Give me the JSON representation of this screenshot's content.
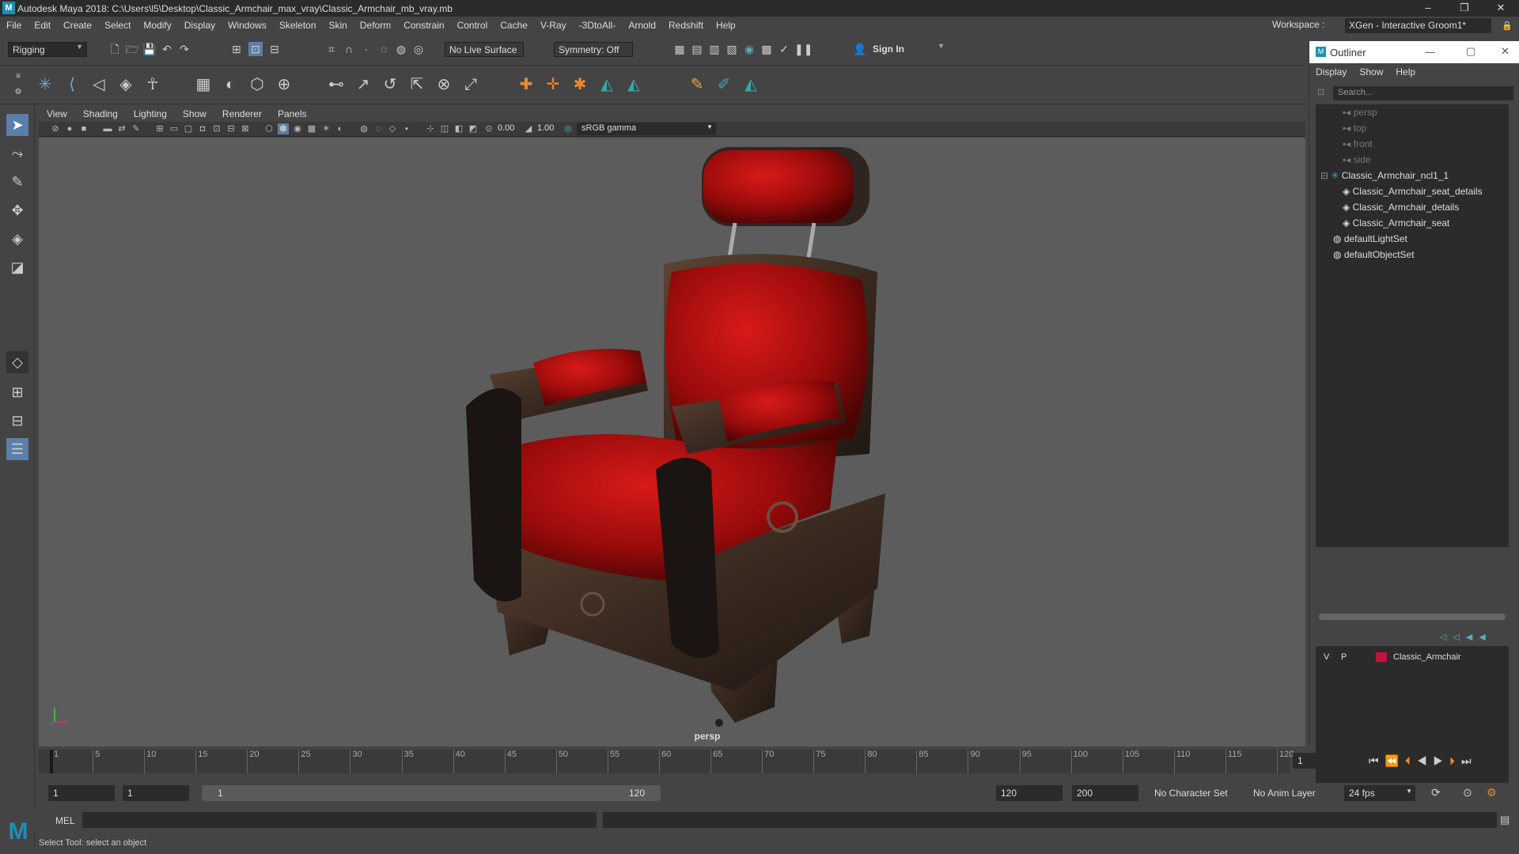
{
  "window": {
    "title": "Autodesk Maya 2018: C:\\Users\\l5\\Desktop\\Classic_Armchair_max_vray\\Classic_Armchair_mb_vray.mb",
    "minimize": "–",
    "maximize": "❐",
    "close": "✕"
  },
  "menus": [
    "File",
    "Edit",
    "Create",
    "Select",
    "Modify",
    "Display",
    "Windows",
    "Skeleton",
    "Skin",
    "Deform",
    "Constrain",
    "Control",
    "Cache",
    "V-Ray",
    "-3DtoAll-",
    "Arnold",
    "Redshift",
    "Help"
  ],
  "workspace": {
    "label": "Workspace :",
    "value": "XGen - Interactive Groom1*"
  },
  "statusline": {
    "mode": "Rigging",
    "live_surface": "No Live Surface",
    "symmetry": "Symmetry: Off",
    "sign_in": "Sign In"
  },
  "viewport": {
    "menus": [
      "View",
      "Shading",
      "Lighting",
      "Show",
      "Renderer",
      "Panels"
    ],
    "exposure": "0.00",
    "gamma": "1.00",
    "color_space": "sRGB gamma",
    "camera": "persp"
  },
  "outliner": {
    "title": "Outliner",
    "menus": [
      "Display",
      "Show",
      "Help"
    ],
    "search_placeholder": "Search...",
    "items": [
      {
        "label": "persp",
        "dim": true
      },
      {
        "label": "top",
        "dim": true
      },
      {
        "label": "front",
        "dim": true
      },
      {
        "label": "side",
        "dim": true
      },
      {
        "label": "Classic_Armchair_ncl1_1",
        "dim": false
      },
      {
        "label": "Classic_Armchair_seat_details",
        "dim": false
      },
      {
        "label": "Classic_Armchair_details",
        "dim": false
      },
      {
        "label": "Classic_Armchair_seat",
        "dim": false
      },
      {
        "label": "defaultLightSet",
        "dim": false
      },
      {
        "label": "defaultObjectSet",
        "dim": false
      }
    ]
  },
  "layers": {
    "v": "V",
    "p": "P",
    "name": "Classic_Armchair",
    "color": "#c0143c"
  },
  "timeline": {
    "ticks": [
      "1",
      "5",
      "10",
      "15",
      "20",
      "25",
      "30",
      "35",
      "40",
      "45",
      "50",
      "55",
      "60",
      "65",
      "70",
      "75",
      "80",
      "85",
      "90",
      "95",
      "100",
      "105",
      "110",
      "115",
      "120"
    ],
    "current_frame": "1"
  },
  "range": {
    "start": "1",
    "playback_start": "1",
    "slider_start": "1",
    "slider_end": "120",
    "playback_end": "120",
    "end": "200",
    "character_set": "No Character Set",
    "anim_layer": "No Anim Layer",
    "fps": "24 fps"
  },
  "command": {
    "label": "MEL"
  },
  "help": {
    "text": "Select Tool: select an object"
  }
}
